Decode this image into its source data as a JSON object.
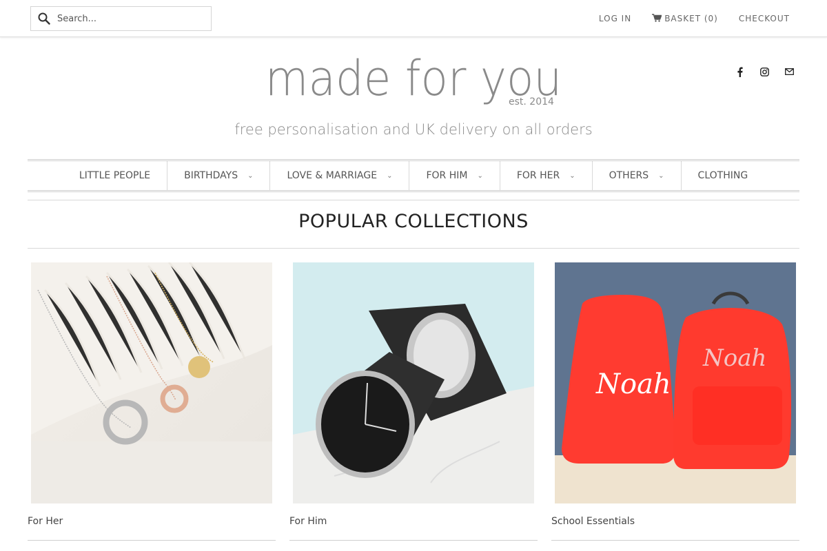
{
  "header": {
    "search_placeholder": "Search...",
    "login": "LOG IN",
    "basket": "BASKET (0)",
    "checkout": "CHECKOUT"
  },
  "brand": {
    "title": "made for you",
    "est": "est. 2014",
    "tagline": "free personalisation and UK delivery on all orders",
    "color": "#8a8a8a"
  },
  "social": [
    "facebook-icon",
    "instagram-icon",
    "mail-icon"
  ],
  "nav": [
    {
      "label": "LITTLE PEOPLE",
      "dropdown": false
    },
    {
      "label": "BIRTHDAYS",
      "dropdown": true
    },
    {
      "label": "LOVE & MARRIAGE",
      "dropdown": true
    },
    {
      "label": "FOR HIM",
      "dropdown": true
    },
    {
      "label": "FOR HER",
      "dropdown": true
    },
    {
      "label": "OTHERS",
      "dropdown": true
    },
    {
      "label": "CLOTHING",
      "dropdown": false
    }
  ],
  "section_title": "POPULAR COLLECTIONS",
  "collections": [
    {
      "label": "For Her"
    },
    {
      "label": "For Him"
    },
    {
      "label": "School Essentials",
      "bag_text": "Noah"
    }
  ]
}
